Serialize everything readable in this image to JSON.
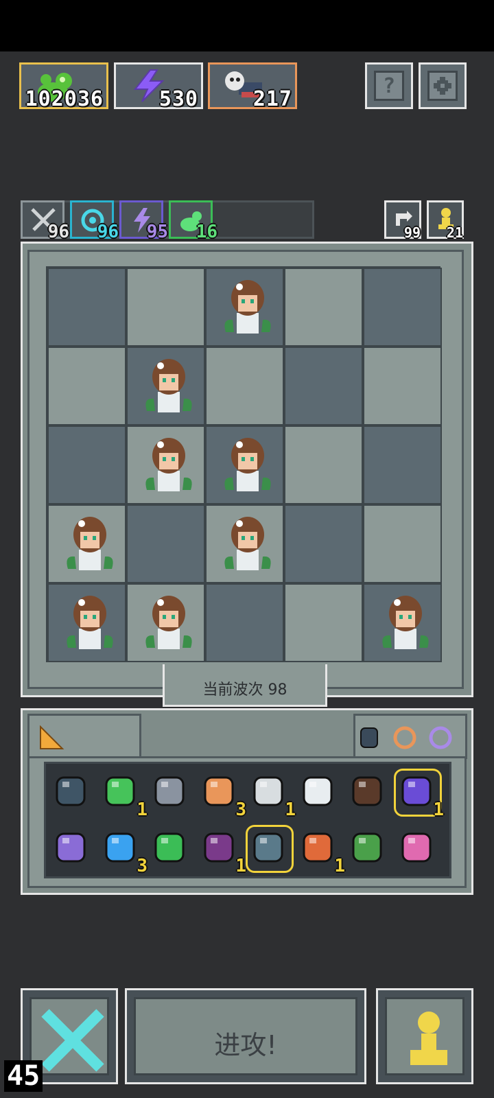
{
  "resources": [
    {
      "name": "slime-currency",
      "value": "102036",
      "color": "#e9c04c"
    },
    {
      "name": "energy",
      "value": "530",
      "color": "#e6e6e6"
    },
    {
      "name": "summon-tickets",
      "value": "217",
      "color": "#e9965a"
    }
  ],
  "top_buttons": {
    "help_label": "?",
    "settings_icon": "gear-icon"
  },
  "buffs": [
    {
      "icon": "sword-icon",
      "value": "96",
      "color": "#e6e6e6"
    },
    {
      "icon": "magic-icon",
      "value": "96",
      "color": "#49d7e8"
    },
    {
      "icon": "lightning-icon",
      "value": "95",
      "color": "#a98ae8"
    },
    {
      "icon": "slime-icon",
      "value": "16",
      "color": "#5ee07a"
    }
  ],
  "right_counters": [
    {
      "icon": "refresh-icon",
      "value": "99"
    },
    {
      "icon": "pawn-icon",
      "value": "21"
    }
  ],
  "board": {
    "wave_text": "当前波次 98",
    "heroes": [
      [
        0,
        2
      ],
      [
        1,
        1
      ],
      [
        2,
        1
      ],
      [
        2,
        2
      ],
      [
        3,
        0
      ],
      [
        3,
        2
      ],
      [
        4,
        0
      ],
      [
        4,
        1
      ],
      [
        4,
        4
      ]
    ]
  },
  "inventory": {
    "items": [
      {
        "icon": "shield-icon",
        "count": ""
      },
      {
        "icon": "emerald-heart-icon",
        "count": "1"
      },
      {
        "icon": "hammer-icon",
        "count": ""
      },
      {
        "icon": "planet-icon",
        "count": "3"
      },
      {
        "icon": "ghost-cannon-icon",
        "count": "1"
      },
      {
        "icon": "mirror-icon",
        "count": ""
      },
      {
        "icon": "spike-crate-icon",
        "count": ""
      },
      {
        "icon": "potion-jar-icon",
        "count": "1"
      },
      {
        "icon": "bat-crown-icon",
        "count": ""
      },
      {
        "icon": "blue-orb-icon",
        "count": "3"
      },
      {
        "icon": "green-arrow-icon",
        "count": ""
      },
      {
        "icon": "demon-mask-icon",
        "count": "1"
      },
      {
        "icon": "spike-trap-icon",
        "count": ""
      },
      {
        "icon": "axe-icon",
        "count": "1"
      },
      {
        "icon": "treasure-chest-icon",
        "count": ""
      },
      {
        "icon": "pink-arrow-icon",
        "count": ""
      }
    ]
  },
  "bottom": {
    "attack_label": "进攻!",
    "fps": "45"
  }
}
